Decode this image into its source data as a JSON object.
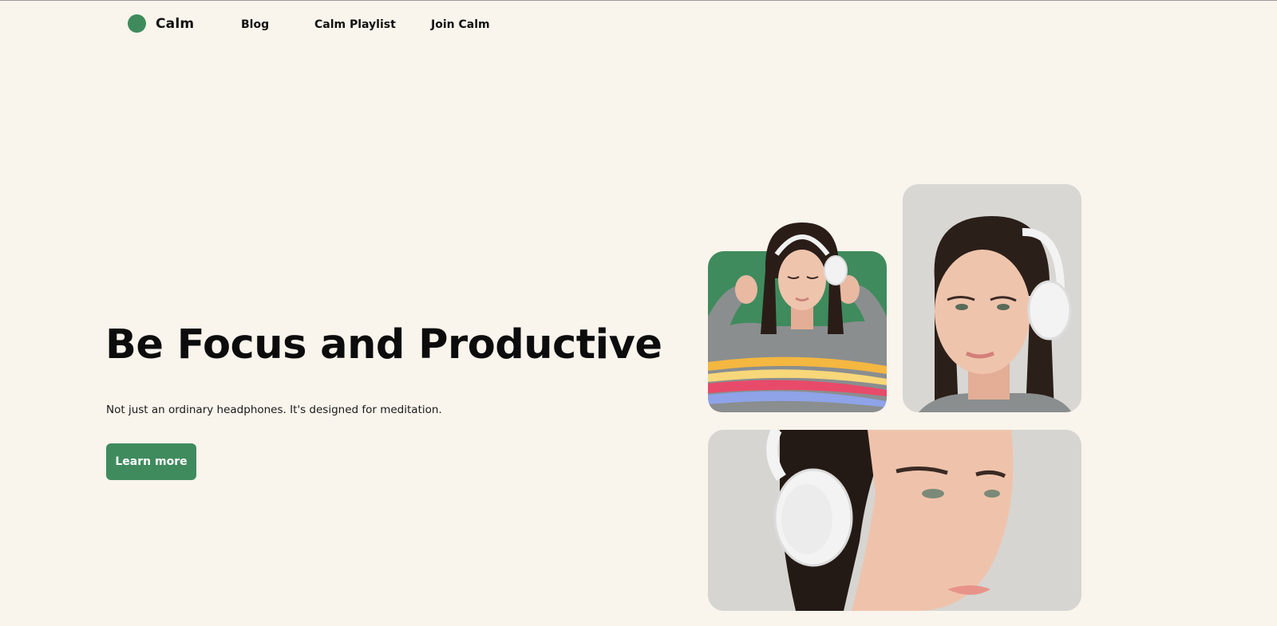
{
  "brand": {
    "name": "Calm",
    "accent_color": "#3f8b5d"
  },
  "nav": {
    "items": [
      {
        "label": "Blog"
      },
      {
        "label": "Calm Playlist"
      },
      {
        "label": "Join Calm"
      }
    ]
  },
  "hero": {
    "title": "Be Focus and Productive",
    "subtitle": "Not just an ordinary headphones. It's designed for meditation.",
    "cta_label": "Learn more"
  },
  "gallery": {
    "images": [
      {
        "subject": "woman-in-striped-sweater-holding-headphones",
        "background": "#3f8b5d"
      },
      {
        "subject": "woman-with-white-headphones-portrait",
        "background": "#d8d7d3"
      },
      {
        "subject": "woman-with-white-headphones-closeup",
        "background": "#d6d5d1"
      }
    ]
  }
}
